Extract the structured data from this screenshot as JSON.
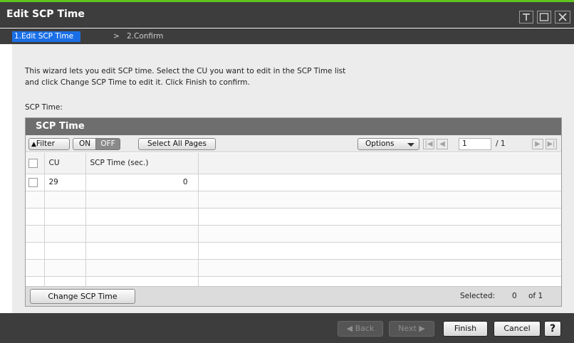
{
  "window": {
    "title": "Edit SCP Time",
    "controls": [
      "pin-icon",
      "maximize-icon",
      "close-icon"
    ]
  },
  "wizard": {
    "steps": [
      {
        "label": "1.Edit SCP Time",
        "active": true
      },
      {
        "label": "2.Confirm",
        "active": false
      }
    ],
    "separator": ">"
  },
  "description": {
    "line1": "This wizard lets you edit SCP time. Select the CU you want to edit in the SCP Time list",
    "line2": "and click Change SCP Time to edit it. Click Finish to confirm."
  },
  "section_label": "SCP Time:",
  "panel": {
    "title": "SCP Time",
    "toolbar": {
      "filter_label": "Filter",
      "on_label": "ON",
      "off_label": "OFF",
      "select_all_label": "Select All Pages",
      "options_label": "Options",
      "page_value": "1",
      "page_total": "/ 1"
    },
    "table": {
      "columns": [
        "CU",
        "SCP Time (sec.)"
      ],
      "rows": [
        {
          "cu": "29",
          "scp_time": "0"
        }
      ]
    },
    "footer": {
      "change_button": "Change SCP Time",
      "selected_label": "Selected:",
      "selected_count": "0",
      "selected_of": "of 1"
    }
  },
  "footer": {
    "back_label": "Back",
    "next_label": "Next",
    "finish_label": "Finish",
    "cancel_label": "Cancel",
    "help_label": "?"
  },
  "colors": {
    "accent_line": "#5fc41e",
    "title_bar": "#3d3d3d",
    "active_step": "#1a6fe6",
    "panel_header": "#6e6e6e"
  }
}
